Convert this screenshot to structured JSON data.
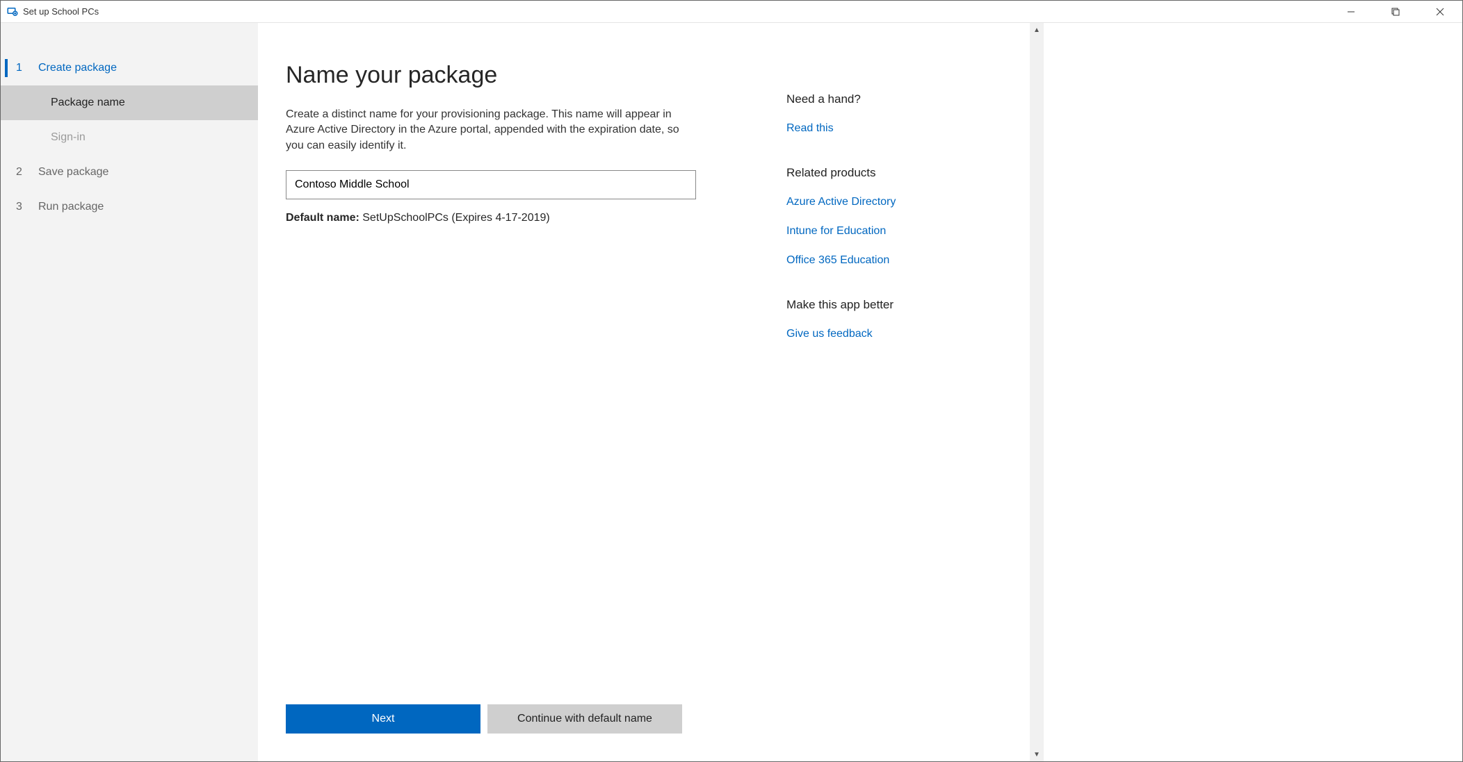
{
  "window": {
    "title": "Set up School PCs"
  },
  "sidebar": {
    "steps": [
      {
        "num": "1",
        "label": "Create package",
        "active": true,
        "subs": [
          {
            "label": "Package name",
            "selected": true
          },
          {
            "label": "Sign-in",
            "selected": false
          }
        ]
      },
      {
        "num": "2",
        "label": "Save package",
        "active": false
      },
      {
        "num": "3",
        "label": "Run package",
        "active": false
      }
    ]
  },
  "main": {
    "title": "Name your package",
    "description": "Create a distinct name for your provisioning package. This name will appear in Azure Active Directory in the Azure portal, appended with the expiration date, so you can easily identify it.",
    "input_value": "Contoso Middle School",
    "default_label": "Default name:",
    "default_value": "SetUpSchoolPCs (Expires 4-17-2019)",
    "buttons": {
      "next": "Next",
      "continue_default": "Continue with default name"
    }
  },
  "aside": {
    "help_heading": "Need a hand?",
    "help_link": "Read this",
    "related_heading": "Related products",
    "related_links": [
      "Azure Active Directory",
      "Intune for Education",
      "Office 365 Education"
    ],
    "feedback_heading": "Make this app better",
    "feedback_link": "Give us feedback"
  }
}
